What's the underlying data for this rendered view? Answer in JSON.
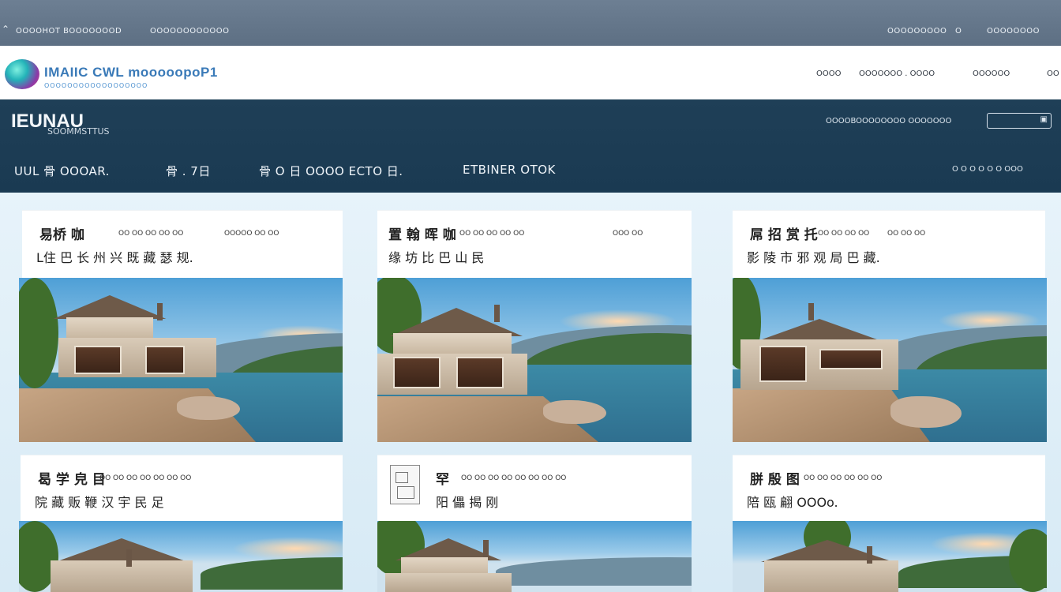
{
  "topbar": {
    "left_text": "OOOOHOT BOOOOOOOD",
    "left_text_2": "OOOOOOOOOOOO",
    "right_text": "OOOOOOOOO",
    "right_icon": "O",
    "right_text_2": "OOOOOOOO"
  },
  "header": {
    "logo_text": "IMAIIC CWL mooooopoP1",
    "logo_sub": "OOOOOOOOOOOOOOOOOO",
    "nav": [
      "OOOO",
      "OOOOOOO . OOOO",
      "OOOOOO"
    ],
    "nav_last": "OO"
  },
  "banner": {
    "brand": "IEUNAU",
    "brand_sub": "SOOMMSTTUS",
    "right_text": "OOOOBOOOOOOOO OOOOOOO",
    "nav": [
      "UUL 骨 OOOAR.",
      "骨 . 7日",
      "骨 O 日 OOOO ECTO 日.",
      "ETBINER OTOK"
    ],
    "nav_right": "O O O O O O  OOO",
    "search_placeholder": ""
  },
  "cards": [
    {
      "title": "易桥 咖",
      "meta": "OO OO OO OO OO",
      "meta2": "OOOOO OO OO",
      "subtitle": "L住 巴 长 州 兴 既 藏 瑟 规."
    },
    {
      "title": "置 翰 晖 咖",
      "meta": "OO OO OO OO OO",
      "meta2": "OOO OO",
      "subtitle": "缘 坊 比 巴 山 民"
    },
    {
      "title": "屌 招 赏 托",
      "meta": "OO OO OO OO",
      "meta2": "OO OO OO",
      "subtitle": "影 陵 市 邪 观 局 巴 藏."
    },
    {
      "title": "曷 学 皃 目",
      "meta": "OO OO OO OO OO OO OO",
      "meta2": "",
      "subtitle": "院 藏 贩 鞭 汉 宇 民 足"
    },
    {
      "title": "罕",
      "meta": "OO OO OO OO OO OO OO OO",
      "meta2": "",
      "subtitle": "阳 儡 揭 刚"
    },
    {
      "title": "胼 殷 图",
      "meta": "OO OO OO OO OO OO",
      "meta2": "",
      "subtitle": "陪 瓯 翩 OOOo."
    }
  ]
}
